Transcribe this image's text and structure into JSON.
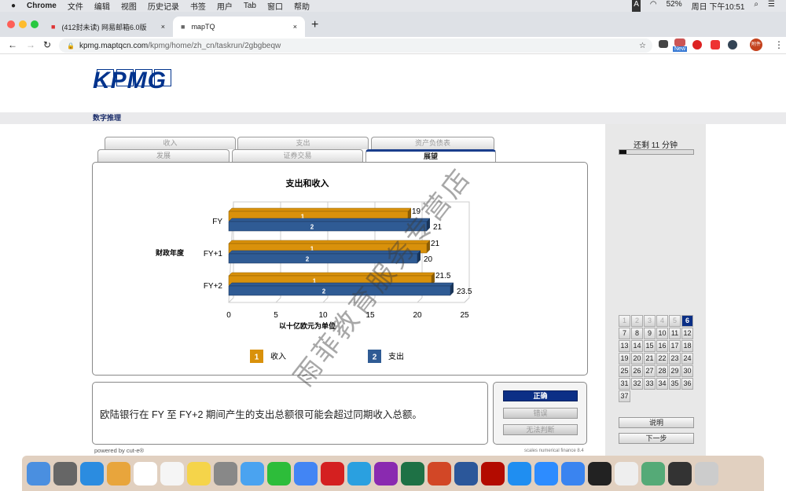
{
  "menubar": {
    "app": "Chrome",
    "items": [
      "文件",
      "编辑",
      "视图",
      "历史记录",
      "书签",
      "用户",
      "Tab",
      "窗口",
      "帮助"
    ],
    "battery": "52%",
    "clock": "周日 下午10:51",
    "input": "A"
  },
  "browser": {
    "tabs": [
      {
        "title": "(412封未读) 网易邮箱6.0版"
      },
      {
        "title": "mapTQ"
      }
    ],
    "url_host": "kpmg.maptqcn.com",
    "url_path": "/kpmg/home/zh_cn/taskrun/2gbgbeqw",
    "badge_new": "New",
    "avatar": "附件"
  },
  "page": {
    "logo": "KPMG",
    "section": "数字推理",
    "tabs_back": [
      "收入",
      "支出",
      "资产负债表"
    ],
    "tabs_front": [
      "发展",
      "证券交易",
      "展望"
    ],
    "question": "欧陆银行在 FY 至 FY+2 期间产生的支出总额很可能会超过同期收入总额。",
    "answers": [
      "正确",
      "错误",
      "无法判断"
    ],
    "powered": "powered by cut-e®",
    "version": "scales numerical finance 8.4",
    "timer": "还剩 11 分钟",
    "timer_fraction": 0.1,
    "questions": [
      "1",
      "2",
      "3",
      "4",
      "5",
      "6",
      "7",
      "8",
      "9",
      "10",
      "11",
      "12",
      "13",
      "14",
      "15",
      "16",
      "17",
      "18",
      "19",
      "20",
      "21",
      "22",
      "23",
      "24",
      "25",
      "26",
      "27",
      "28",
      "29",
      "30",
      "31",
      "32",
      "33",
      "34",
      "35",
      "36",
      "37"
    ],
    "current_question": 6,
    "help_btn": "说明",
    "next_btn": "下一步",
    "watermark": "雨菲教育服务专营店"
  },
  "colors": {
    "income": "#d9910b",
    "expense": "#2f5b94",
    "brand": "#00338d"
  },
  "chart_data": {
    "type": "bar",
    "orientation": "horizontal",
    "title": "支出和收入",
    "ylabel": "财政年度",
    "xlabel": "以十亿欧元为单位",
    "categories": [
      "FY",
      "FY+1",
      "FY+2"
    ],
    "series": [
      {
        "name": "收入",
        "marker": "1",
        "values": [
          19,
          21,
          21.5
        ]
      },
      {
        "name": "支出",
        "marker": "2",
        "values": [
          21,
          20,
          23.5
        ]
      }
    ],
    "value_labels": [
      [
        "19",
        "21",
        "21.5"
      ],
      [
        "21",
        "20",
        "23.5"
      ]
    ],
    "xlim": [
      0,
      25
    ],
    "xticks": [
      "0",
      "5",
      "10",
      "15",
      "20",
      "25"
    ],
    "grid": true,
    "legend": "bottom"
  }
}
